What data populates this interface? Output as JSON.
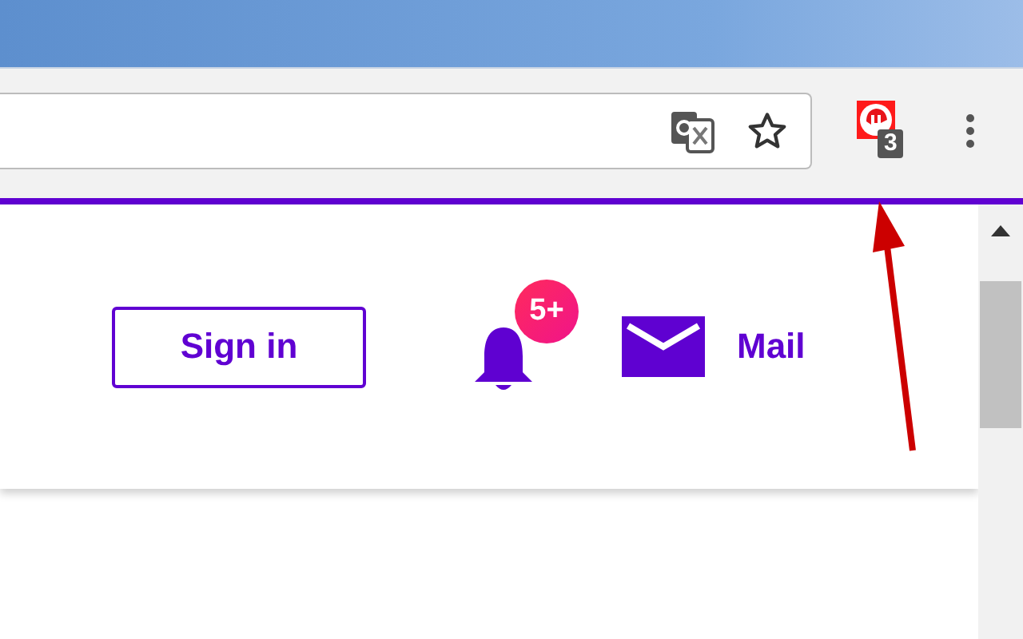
{
  "toolbar": {
    "extension_badge": "3"
  },
  "header": {
    "sign_in": "Sign in",
    "notification_badge": "5+",
    "mail_label": "Mail"
  }
}
